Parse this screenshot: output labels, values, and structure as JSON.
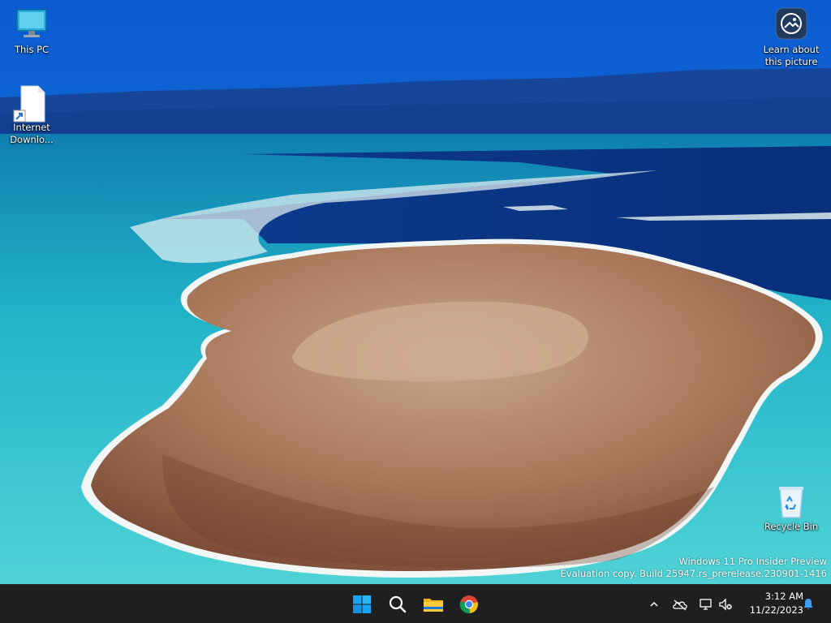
{
  "desktop": {
    "icons": [
      {
        "label": "This PC",
        "icon": "this-pc-icon"
      },
      {
        "label": "Internet Downlo...",
        "icon": "shortcut-file-icon"
      },
      {
        "label": "Learn about this picture",
        "icon": "learn-about-picture-icon"
      },
      {
        "label": "Recycle Bin",
        "icon": "recycle-bin-icon"
      }
    ]
  },
  "watermark": {
    "line1": "Windows 11 Pro Insider Preview",
    "line2": "Evaluation copy. Build 25947.rs_prerelease.230901-1416"
  },
  "taskbar": {
    "apps": [
      {
        "name": "Start",
        "icon": "windows-start-icon"
      },
      {
        "name": "Search",
        "icon": "search-icon"
      },
      {
        "name": "File Explorer",
        "icon": "folder-icon"
      },
      {
        "name": "Google Chrome",
        "icon": "chrome-icon"
      }
    ],
    "tray": {
      "icons": [
        "chevron-up-icon",
        "onedrive-icon",
        "network-icon",
        "volume-muted-icon",
        "notification-bell-icon"
      ],
      "time": "3:12 AM",
      "date": "11/22/2023"
    },
    "colors": {
      "background": "#1f1f1f",
      "accent": "#0078d4"
    }
  }
}
